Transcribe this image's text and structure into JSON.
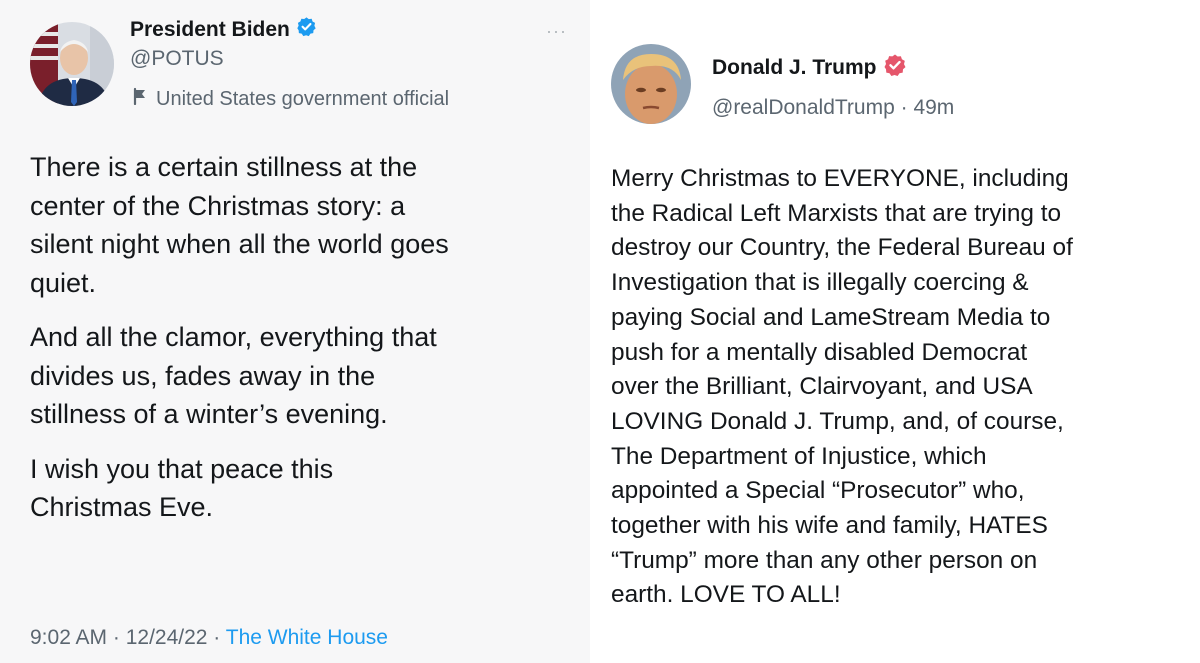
{
  "left_post": {
    "name": "President Biden",
    "handle": "@POTUS",
    "label": "United States government official",
    "body": [
      [
        "There is a certain stillness at the",
        "center of the Christmas story: a",
        "silent night when all the world goes",
        "quiet."
      ],
      [
        "And all the clamor, everything that",
        "divides us, fades away in the",
        "stillness of a winter’s evening."
      ],
      [
        "I wish you that peace this",
        "Christmas Eve."
      ]
    ],
    "timestamp": "9:02 AM · 12/24/22 · ",
    "source": "The White House",
    "more_icon": "···",
    "verified_color": "#1d9bf0"
  },
  "right_post": {
    "name": "Donald J. Trump",
    "handle_time": "@realDonaldTrump · 49m",
    "body": [
      "Merry Christmas to EVERYONE, including",
      "the Radical Left Marxists that are trying to",
      "destroy our Country, the Federal Bureau of",
      "Investigation that is illegally coercing &",
      "paying Social and LameStream Media to",
      "push for a mentally disabled Democrat",
      "over the Brilliant, Clairvoyant, and USA",
      "LOVING Donald J. Trump,  and, of course,",
      "The Department of Injustice, which",
      "appointed a Special “Prosecutor” who,",
      "together with his wife and family, HATES",
      "“Trump” more than any other person on",
      "earth. LOVE TO ALL!"
    ],
    "verified_color": "#e5566b"
  }
}
